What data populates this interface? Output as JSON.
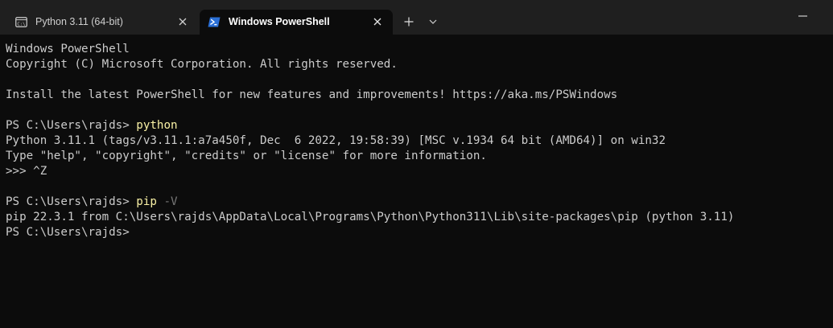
{
  "window": {
    "colors": {
      "tabbar_bg": "#1f1f1f",
      "terminal_bg": "#0c0c0c",
      "text": "#cccccc",
      "command": "#f9f1a5",
      "parameter": "#767676"
    }
  },
  "tabs": [
    {
      "title": "Python 3.11 (64-bit)",
      "icon": "console-icon",
      "active": false
    },
    {
      "title": "Windows PowerShell",
      "icon": "powershell-icon",
      "active": true
    }
  ],
  "terminal": {
    "lines": [
      {
        "text": "Windows PowerShell"
      },
      {
        "text": "Copyright (C) Microsoft Corporation. All rights reserved."
      },
      {
        "text": ""
      },
      {
        "text": "Install the latest PowerShell for new features and improvements! https://aka.ms/PSWindows"
      },
      {
        "text": ""
      },
      {
        "prompt": "PS C:\\Users\\rajds> ",
        "command": "python"
      },
      {
        "text": "Python 3.11.1 (tags/v3.11.1:a7a450f, Dec  6 2022, 19:58:39) [MSC v.1934 64 bit (AMD64)] on win32"
      },
      {
        "text": "Type \"help\", \"copyright\", \"credits\" or \"license\" for more information."
      },
      {
        "text": ">>> ^Z"
      },
      {
        "text": ""
      },
      {
        "prompt": "PS C:\\Users\\rajds> ",
        "command": "pip",
        "param": " -V"
      },
      {
        "text": "pip 22.3.1 from C:\\Users\\rajds\\AppData\\Local\\Programs\\Python\\Python311\\Lib\\site-packages\\pip (python 3.11)"
      },
      {
        "prompt": "PS C:\\Users\\rajds>"
      }
    ]
  }
}
